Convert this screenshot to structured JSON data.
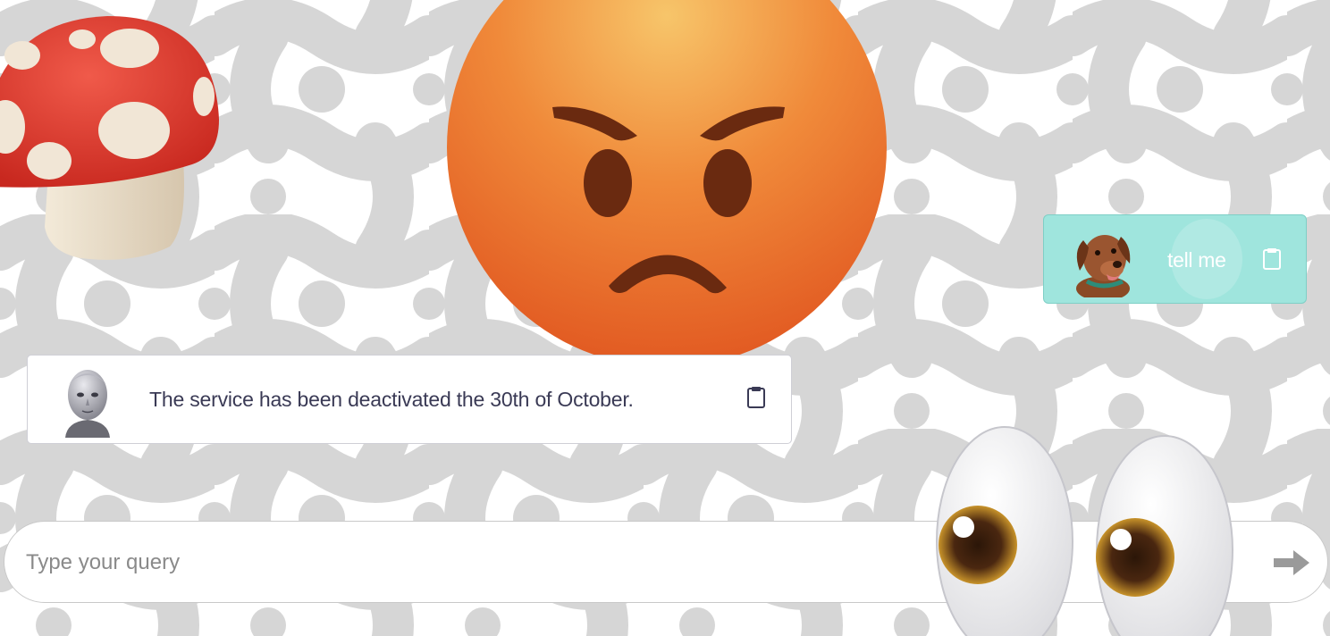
{
  "chat": {
    "messages": [
      {
        "role": "user",
        "text": "tell me",
        "avatar": "dog-avatar",
        "copy_icon": "clipboard-icon"
      },
      {
        "role": "bot",
        "text": "The service has been deactivated the 30th of October.",
        "avatar": "robot-avatar",
        "copy_icon": "clipboard-icon"
      }
    ]
  },
  "input": {
    "placeholder": "Type your query",
    "value": "",
    "send_icon": "arrow-right-icon"
  },
  "decorations": [
    "mushroom-emoji",
    "angry-face-emoji",
    "eyes-emoji"
  ],
  "colors": {
    "user_bubble": "#9fe5dd",
    "bot_text": "#3a3a55",
    "background_pattern": "#d6d6d6",
    "send_arrow": "#9a9a9a"
  }
}
